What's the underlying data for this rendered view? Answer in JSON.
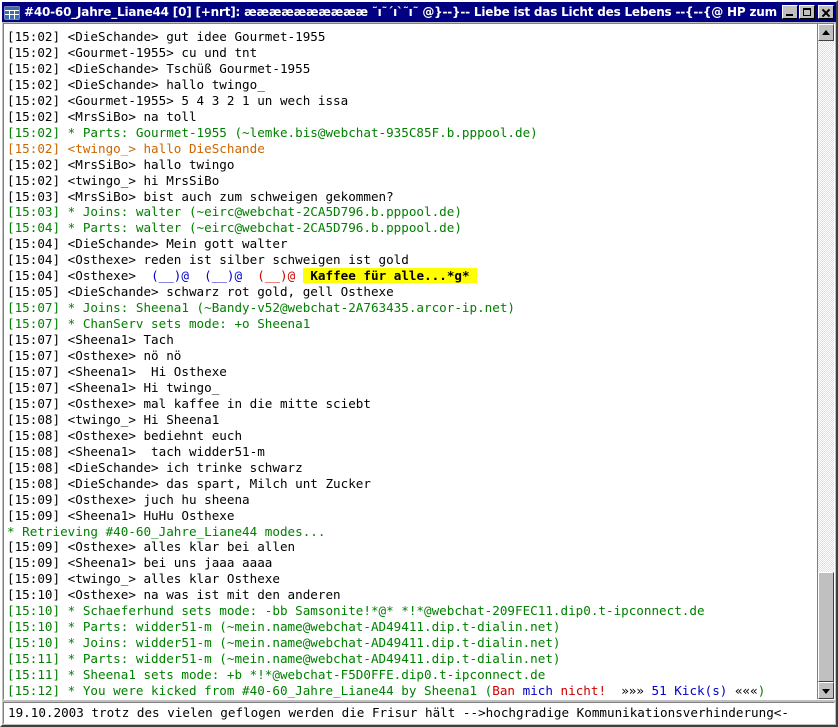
{
  "window": {
    "title": "#40-60_Jahre_Liane44 [0] [+nrt]: ææææææææææ ˜ı˜´ı`˜ı˜ @}--}-- Liebe ist das Licht des Lebens --{--{@ HP zum Raum @ htt...",
    "icon": "channel-window-icon",
    "buttons": {
      "minimize": "minimize-button",
      "maximize": "maximize-button",
      "close": "close-button"
    }
  },
  "colors": {
    "titlebar": "#000080",
    "titlebar_text": "#ffffff",
    "window_face": "#c0c0c0",
    "chat_background": "#ffffff",
    "normal_text": "#000000",
    "event_green": "#008000",
    "highlight_orange": "#cc6600",
    "accent_blue": "#0000cc",
    "accent_red": "#cc0000",
    "highlight_background": "#ffff00"
  },
  "chat": {
    "lines": [
      {
        "segments": [
          {
            "text": "[15:02] <DieSchande> gut idee Gourmet-1955",
            "color": "black"
          }
        ]
      },
      {
        "segments": [
          {
            "text": "[15:02] <Gourmet-1955> cu und tnt",
            "color": "black"
          }
        ]
      },
      {
        "segments": [
          {
            "text": "[15:02] <DieSchande> Tschüß Gourmet-1955",
            "color": "black"
          }
        ]
      },
      {
        "segments": [
          {
            "text": "[15:02] <DieSchande> hallo twingo_",
            "color": "black"
          }
        ]
      },
      {
        "segments": [
          {
            "text": "[15:02] <Gourmet-1955> 5 4 3 2 1 un wech issa",
            "color": "black"
          }
        ]
      },
      {
        "segments": [
          {
            "text": "[15:02] <MrsSiBo> na toll",
            "color": "black"
          }
        ]
      },
      {
        "segments": [
          {
            "text": "[15:02] * Parts: Gourmet-1955 (~lemke.bis@webchat-935C85F.b.pppool.de)",
            "color": "green"
          }
        ]
      },
      {
        "segments": [
          {
            "text": "[15:02] <twingo_> hallo DieSchande",
            "color": "orange"
          }
        ]
      },
      {
        "segments": [
          {
            "text": "[15:02] <MrsSiBo> hallo twingo",
            "color": "black"
          }
        ]
      },
      {
        "segments": [
          {
            "text": "[15:02] <twingo_> hi MrsSiBo",
            "color": "black"
          }
        ]
      },
      {
        "segments": [
          {
            "text": "[15:03] <MrsSiBo> bist auch zum schweigen gekommen?",
            "color": "black"
          }
        ]
      },
      {
        "segments": [
          {
            "text": "[15:03] * Joins: walter (~eirc@webchat-2CA5D796.b.pppool.de)",
            "color": "green"
          }
        ]
      },
      {
        "segments": [
          {
            "text": "[15:04] * Parts: walter (~eirc@webchat-2CA5D796.b.pppool.de)",
            "color": "green"
          }
        ]
      },
      {
        "segments": [
          {
            "text": "[15:04] <DieSchande> Mein gott walter",
            "color": "black"
          }
        ]
      },
      {
        "segments": [
          {
            "text": "[15:04] <Osthexe> reden ist silber schweigen ist gold",
            "color": "black"
          }
        ]
      },
      {
        "segments": [
          {
            "text": "[15:04] <Osthexe>  ",
            "color": "black"
          },
          {
            "text": "(__)@",
            "color": "blue"
          },
          {
            "text": "  ",
            "color": "black"
          },
          {
            "text": "(__)@",
            "color": "blue"
          },
          {
            "text": "  ",
            "color": "black"
          },
          {
            "text": "(__)@",
            "color": "red"
          },
          {
            "text": " ",
            "color": "black"
          },
          {
            "text": " Kaffee für alle...*g* ",
            "color": "black",
            "highlight": true
          }
        ]
      },
      {
        "segments": [
          {
            "text": "[15:05] <DieSchande> schwarz rot gold, gell Osthexe",
            "color": "black"
          }
        ]
      },
      {
        "segments": [
          {
            "text": "[15:07] * Joins: Sheena1 (~Bandy-v52@webchat-2A763435.arcor-ip.net)",
            "color": "green"
          }
        ]
      },
      {
        "segments": [
          {
            "text": "[15:07] * ChanServ sets mode: +o Sheena1",
            "color": "green"
          }
        ]
      },
      {
        "segments": [
          {
            "text": "[15:07] <Sheena1> Tach",
            "color": "black"
          }
        ]
      },
      {
        "segments": [
          {
            "text": "[15:07] <Osthexe> nö nö",
            "color": "black"
          }
        ]
      },
      {
        "segments": [
          {
            "text": "[15:07] <Sheena1>  Hi Osthexe",
            "color": "black"
          }
        ]
      },
      {
        "segments": [
          {
            "text": "[15:07] <Sheena1> Hi twingo_",
            "color": "black"
          }
        ]
      },
      {
        "segments": [
          {
            "text": "[15:07] <Osthexe> mal kaffee in die mitte sciebt",
            "color": "black"
          }
        ]
      },
      {
        "segments": [
          {
            "text": "[15:08] <twingo_> Hi Sheena1",
            "color": "black"
          }
        ]
      },
      {
        "segments": [
          {
            "text": "[15:08] <Osthexe> bediehnt euch",
            "color": "black"
          }
        ]
      },
      {
        "segments": [
          {
            "text": "[15:08] <Sheena1>  tach widder51-m",
            "color": "black"
          }
        ]
      },
      {
        "segments": [
          {
            "text": "[15:08] <DieSchande> ich trinke schwarz",
            "color": "black"
          }
        ]
      },
      {
        "segments": [
          {
            "text": "[15:08] <DieSchande> das spart, Milch unt Zucker",
            "color": "black"
          }
        ]
      },
      {
        "segments": [
          {
            "text": "[15:09] <Osthexe> juch hu sheena",
            "color": "black"
          }
        ]
      },
      {
        "segments": [
          {
            "text": "[15:09] <Sheena1> HuHu Osthexe",
            "color": "black"
          }
        ]
      },
      {
        "segments": [
          {
            "text": "* Retrieving #40-60_Jahre_Liane44 modes...",
            "color": "green"
          }
        ]
      },
      {
        "segments": [
          {
            "text": "[15:09] <Osthexe> alles klar bei allen",
            "color": "black"
          }
        ]
      },
      {
        "segments": [
          {
            "text": "[15:09] <Sheena1> bei uns jaaa aaaa",
            "color": "black"
          }
        ]
      },
      {
        "segments": [
          {
            "text": "[15:09] <twingo_> alles klar Osthexe",
            "color": "black"
          }
        ]
      },
      {
        "segments": [
          {
            "text": "[15:10] <Osthexe> na was ist mit den anderen",
            "color": "black"
          }
        ]
      },
      {
        "segments": [
          {
            "text": "[15:10] * Schaeferhund sets mode: -bb Samsonite!*@* *!*@webchat-209FEC11.dip0.t-ipconnect.de",
            "color": "green"
          }
        ]
      },
      {
        "segments": [
          {
            "text": "[15:10] * Parts: widder51-m (~mein.name@webchat-AD49411.dip.t-dialin.net)",
            "color": "green"
          }
        ]
      },
      {
        "segments": [
          {
            "text": "[15:10] * Joins: widder51-m (~mein.name@webchat-AD49411.dip.t-dialin.net)",
            "color": "green"
          }
        ]
      },
      {
        "segments": [
          {
            "text": "[15:11] * Parts: widder51-m (~mein.name@webchat-AD49411.dip.t-dialin.net)",
            "color": "green"
          }
        ]
      },
      {
        "segments": [
          {
            "text": "[15:11] * Sheena1 sets mode: +b *!*@webchat-F5D0FFE.dip0.t-ipconnect.de",
            "color": "green"
          }
        ]
      },
      {
        "segments": [
          {
            "text": "[15:12] * You were kicked from #40-60_Jahre_Liane44 by Sheena1 (",
            "color": "green"
          },
          {
            "text": "Ban ",
            "color": "red"
          },
          {
            "text": "mich ",
            "color": "blue"
          },
          {
            "text": "nicht!",
            "color": "red"
          },
          {
            "text": "  ",
            "color": "black"
          },
          {
            "text": "»»»",
            "color": "black"
          },
          {
            "text": " ",
            "color": "black"
          },
          {
            "text": "51 Kick(s)",
            "color": "blue"
          },
          {
            "text": " ",
            "color": "black"
          },
          {
            "text": "«««",
            "color": "black"
          },
          {
            "text": ")",
            "color": "green"
          }
        ]
      }
    ]
  },
  "scrollbar": {
    "up_arrow": "scroll-up-icon",
    "down_arrow": "scroll-down-icon",
    "position": "bottom"
  },
  "statusbar": {
    "text": "19.10.2003 trotz des vielen geflogen werden die Frisur hält -->hochgradige Kommunikationsverhinderung<-"
  }
}
